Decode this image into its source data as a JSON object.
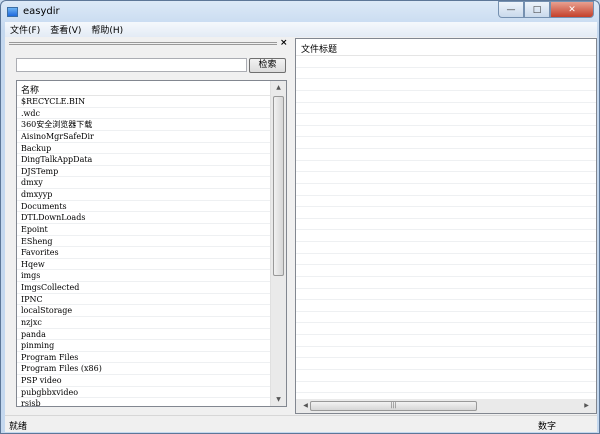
{
  "window": {
    "title": "easydir",
    "controls": {
      "minimize": "—",
      "maximize": "□",
      "close": "✕"
    }
  },
  "menu": [
    "文件(F)",
    "查看(V)",
    "帮助(H)"
  ],
  "left_pane": {
    "close": "×",
    "search_value": "",
    "search_button": "检索",
    "column_header": "名称",
    "items": [
      "$RECYCLE.BIN",
      ".wdc",
      "360安全浏览器下载",
      "AisinoMgrSafeDir",
      "Backup",
      "DingTalkAppData",
      "DJSTemp",
      "dmxy",
      "dmxyyp",
      "Documents",
      "DTLDownLoads",
      "Epoint",
      "ESheng",
      "Favorites",
      "Hqew",
      "imgs",
      "ImgsCollected",
      "IPNC",
      "localStorage",
      "nzjxc",
      "panda",
      "pinming",
      "Program Files",
      "Program Files (x86)",
      "PSP video",
      "pubgbbxvideo",
      "rsjsb"
    ]
  },
  "right_pane": {
    "column_header": "文件标题"
  },
  "status": {
    "left": "就绪",
    "right": "数字"
  }
}
